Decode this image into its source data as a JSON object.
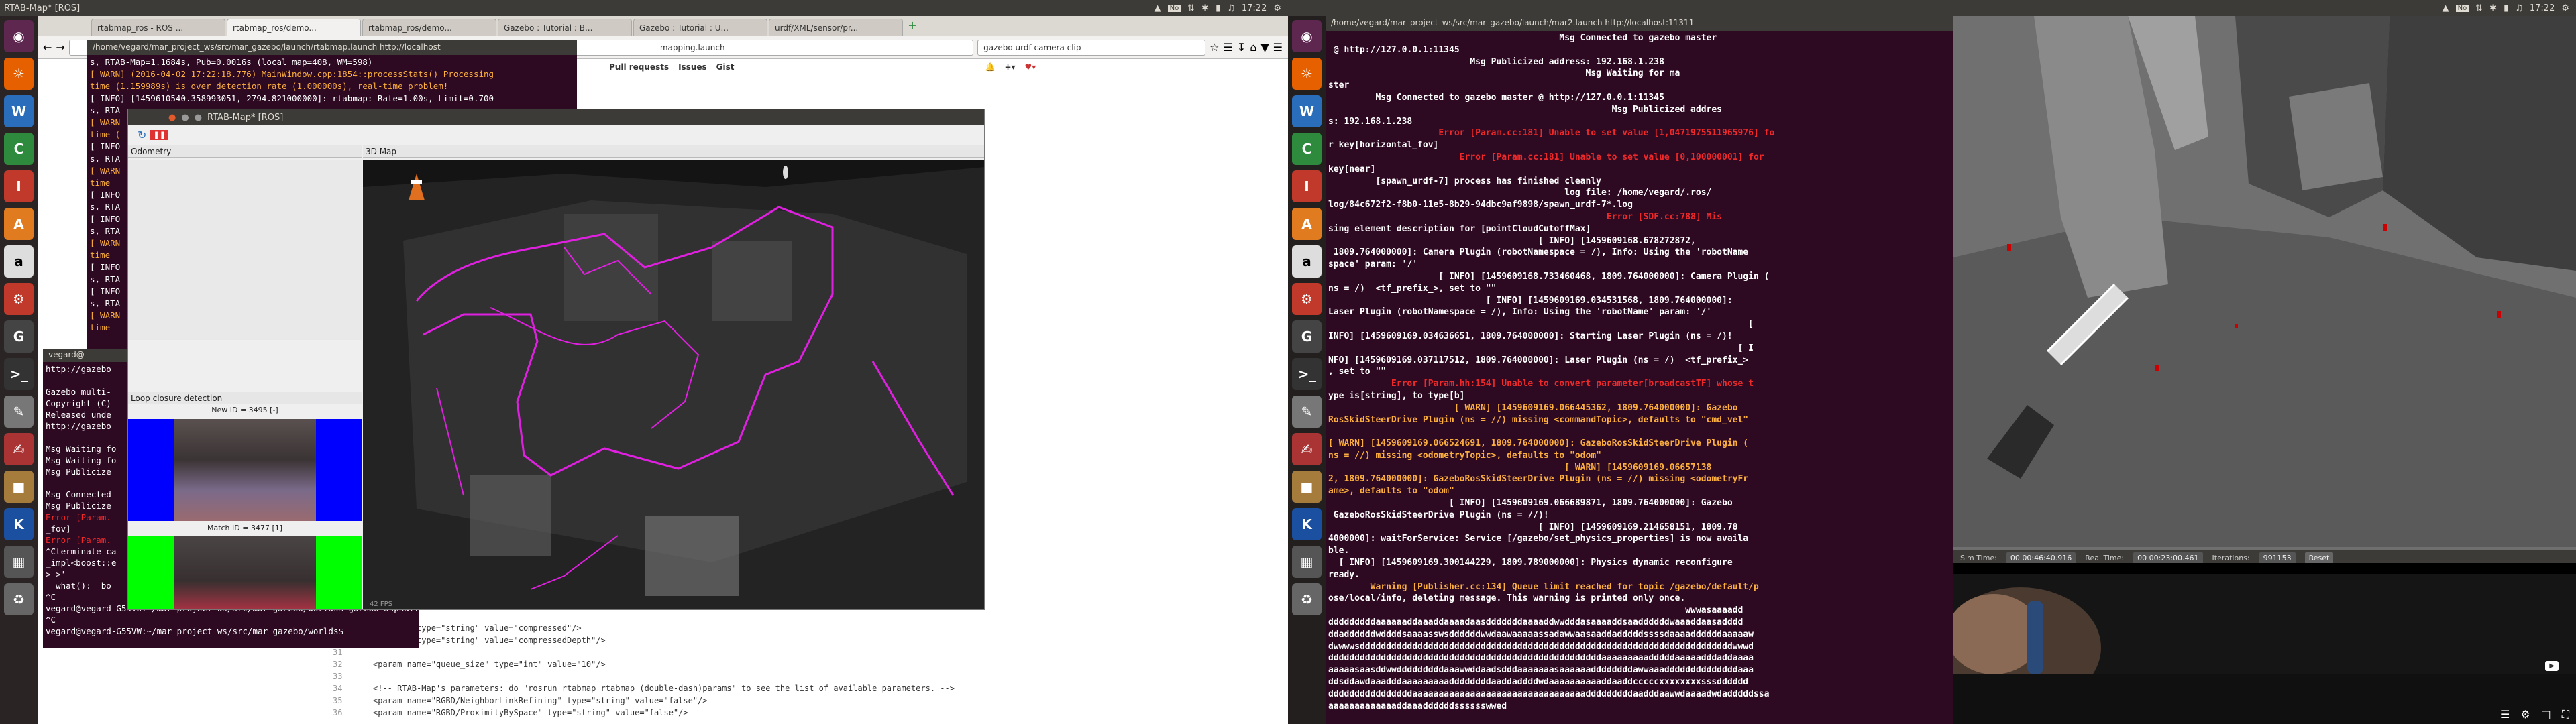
{
  "left": {
    "window_title": "RTAB-Map* [ROS]",
    "clock": "17:22",
    "browser": {
      "tabs": [
        "rtabmap_ros - ROS ...",
        "rtabmap_ros/demo...",
        "rtabmap_ros/demo...",
        "Gazebo : Tutorial : B...",
        "Gazebo : Tutorial : U...",
        "urdf/XML/sensor/pr..."
      ],
      "search_text": "gazebo urdf camera clip",
      "url_text": "mapping.launch",
      "gh_links": [
        "Pull requests",
        "Issues",
        "Gist"
      ]
    },
    "term_top": {
      "title": "/home/vegard/mar_project_ws/src/mar_gazebo/launch/rtabmap.launch http://localhost",
      "lines": [
        {
          "t": "s, RTAB-Map=1.1684s, Pub=0.0016s (local map=408, WM=598)",
          "c": "dark"
        },
        {
          "t": "[ WARN] (2016-04-02 17:22:18.776) MainWindow.cpp:1854::processStats() Processing",
          "c": "warn"
        },
        {
          "t": "time (1.159989s) is over detection rate (1.000000s), real-time problem!",
          "c": "warn"
        },
        {
          "t": "[ INFO] [1459610540.358993051, 2794.821000000]: rtabmap: Rate=1.00s, Limit=0.700",
          "c": "dark"
        },
        {
          "t": "s, RTA",
          "c": "dark"
        },
        {
          "t": "[ WARN",
          "c": "warn"
        },
        {
          "t": "time (",
          "c": "warn"
        },
        {
          "t": "[ INFO",
          "c": "dark"
        },
        {
          "t": "s, RTA",
          "c": "dark"
        },
        {
          "t": "[ WARN",
          "c": "warn"
        },
        {
          "t": "time",
          "c": "warn"
        },
        {
          "t": "[ INFO",
          "c": "dark"
        },
        {
          "t": "s, RTA",
          "c": "dark"
        },
        {
          "t": "[ INFO",
          "c": "dark"
        },
        {
          "t": "s, RTA",
          "c": "dark"
        },
        {
          "t": "[ WARN",
          "c": "warn"
        },
        {
          "t": "time",
          "c": "warn"
        },
        {
          "t": "[ INFO",
          "c": "dark"
        },
        {
          "t": "s, RTA",
          "c": "dark"
        },
        {
          "t": "[ INFO",
          "c": "dark"
        },
        {
          "t": "s, RTA",
          "c": "dark"
        },
        {
          "t": "[ WARN",
          "c": "warn"
        },
        {
          "t": "time",
          "c": "warn"
        }
      ]
    },
    "term_bottom": {
      "title": "vegard@",
      "lines": [
        {
          "t": "http://gazebo",
          "c": "dark"
        },
        {
          "t": "",
          "c": "dark"
        },
        {
          "t": "Gazebo multi-",
          "c": "dark"
        },
        {
          "t": "Copyright (C)",
          "c": "dark"
        },
        {
          "t": "Released unde",
          "c": "dark"
        },
        {
          "t": "http://gazebo",
          "c": "dark"
        },
        {
          "t": "",
          "c": "dark"
        },
        {
          "t": "Msg Waiting fo",
          "c": "dark"
        },
        {
          "t": "Msg Waiting fo",
          "c": "dark"
        },
        {
          "t": "Msg Publicize",
          "c": "dark"
        },
        {
          "t": "",
          "c": "dark"
        },
        {
          "t": "Msg Connected",
          "c": "dark"
        },
        {
          "t": "Msg Publicize",
          "c": "dark"
        },
        {
          "t": "Error [Param.",
          "c": "err"
        },
        {
          "t": "_fov]",
          "c": "dark"
        },
        {
          "t": "Error [Param.",
          "c": "err"
        },
        {
          "t": "^Cterminate ca",
          "c": "dark"
        },
        {
          "t": "_impl<boost::e",
          "c": "dark"
        },
        {
          "t": "> >'",
          "c": "dark"
        },
        {
          "t": "  what():  bo",
          "c": "dark"
        },
        {
          "t": "^C",
          "c": "dark"
        },
        {
          "t": "vegard@vegard-G55VW:~/mar_project_ws/src/mar_gazebo/worlds$ gazebo asphalt.world",
          "c": "dark"
        },
        {
          "t": "^C",
          "c": "dark"
        },
        {
          "t": "vegard@vegard-G55VW:~/mar_project_ws/src/mar_gazebo/worlds$ ",
          "c": "dark"
        }
      ]
    },
    "code_lines": [
      {
        "n": "",
        "t": "ansport\"    type=\"string\" value=\"compressed\"/>"
      },
      {
        "n": "",
        "t": "ansport\"   type=\"string\" value=\"compressedDepth\"/>"
      },
      {
        "n": "31",
        "t": ""
      },
      {
        "n": "32",
        "t": "<param name=\"queue_size\" type=\"int\" value=\"10\"/>"
      },
      {
        "n": "33",
        "t": ""
      },
      {
        "n": "34",
        "t": "<!-- RTAB-Map's parameters: do \"rosrun rtabmap rtabmap (double-dash)params\" to see the list of available parameters. -->"
      },
      {
        "n": "35",
        "t": "<param name=\"RGBD/NeighborLinkRefining\" type=\"string\" value=\"false\"/>"
      },
      {
        "n": "36",
        "t": "<param name=\"RGBD/ProximityBySpace\"     type=\"string\" value=\"false\"/>"
      }
    ],
    "rtabmap": {
      "title": "RTAB-Map* [ROS]",
      "odometry_title": "Odometry",
      "loop_title": "Loop closure detection",
      "map3d_title": "3D Map",
      "new_id": "New ID = 3495 [-]",
      "match_id": "Match ID = 3477 [1]",
      "fps": "42 FPS"
    }
  },
  "right": {
    "clock": "17:22",
    "term_title": "/home/vegard/mar_project_ws/src/mar_gazebo/launch/mar2.launch http://localhost:11311",
    "lines": [
      {
        "t": "                                            Msg Connected to gazebo master",
        "c": "dark"
      },
      {
        "t": " @ http://127.0.0.1:11345",
        "c": "dark"
      },
      {
        "t": "                           Msg Publicized address: 192.168.1.238",
        "c": "dark"
      },
      {
        "t": "                                                 Msg Waiting for ma",
        "c": "dark"
      },
      {
        "t": "ster",
        "c": "dark"
      },
      {
        "t": "         Msg Connected to gazebo master @ http://127.0.0.1:11345",
        "c": "dark"
      },
      {
        "t": "                                                      Msg Publicized addres",
        "c": "dark"
      },
      {
        "t": "s: 192.168.1.238",
        "c": "dark"
      },
      {
        "t": "                     Error [Param.cc:181] Unable to set value [1,0471975511965976] fo",
        "c": "err"
      },
      {
        "t": "r key[horizontal_fov]",
        "c": "dark"
      },
      {
        "t": "                         Error [Param.cc:181] Unable to set value [0,100000001] for",
        "c": "err"
      },
      {
        "t": "key[near]",
        "c": "dark"
      },
      {
        "t": "         [spawn_urdf-7] process has finished cleanly",
        "c": "dark"
      },
      {
        "t": "                                             log file: /home/vegard/.ros/",
        "c": "dark"
      },
      {
        "t": "log/84c672f2-f8b0-11e5-8b29-94dbc9af9898/spawn_urdf-7*.log",
        "c": "dark"
      },
      {
        "t": "                                                     Error [SDF.cc:788] Mis",
        "c": "err"
      },
      {
        "t": "sing element description for [pointCloudCutoffMax]",
        "c": "dark"
      },
      {
        "t": "                                        [ INFO] [1459609168.678272872,",
        "c": "dark"
      },
      {
        "t": " 1809.764000000]: Camera Plugin (robotNamespace = /), Info: Using the 'robotName",
        "c": "dark"
      },
      {
        "t": "space' param: '/'",
        "c": "dark"
      },
      {
        "t": "                     [ INFO] [1459609168.733460468, 1809.764000000]: Camera Plugin (",
        "c": "dark"
      },
      {
        "t": "ns = /)  <tf_prefix_>, set to \"\"",
        "c": "dark"
      },
      {
        "t": "                              [ INFO] [1459609169.034531568, 1809.764000000]:",
        "c": "dark"
      },
      {
        "t": "Laser Plugin (robotNamespace = /), Info: Using the 'robotName' param: '/'",
        "c": "dark"
      },
      {
        "t": "                                                                                [",
        "c": "dark"
      },
      {
        "t": "INFO] [1459609169.034636651, 1809.764000000]: Starting Laser Plugin (ns = /)!",
        "c": "dark"
      },
      {
        "t": "                                                                              [ I",
        "c": "dark"
      },
      {
        "t": "NFO] [1459609169.037117512, 1809.764000000]: Laser Plugin (ns = /)  <tf_prefix_>",
        "c": "dark"
      },
      {
        "t": ", set to \"\"",
        "c": "dark"
      },
      {
        "t": "            Error [Param.hh:154] Unable to convert parameter[broadcastTF] whose t",
        "c": "err"
      },
      {
        "t": "ype is[string], to type[b]",
        "c": "dark"
      },
      {
        "t": "                        [ WARN] [1459609169.066445362, 1809.764000000]: Gazebo",
        "c": "warn"
      },
      {
        "t": "RosSkidSteerDrive Plugin (ns = //) missing <commandTopic>, defaults to \"cmd_vel\"",
        "c": "warn"
      },
      {
        "t": "",
        "c": "dark"
      },
      {
        "t": "[ WARN] [1459609169.066524691, 1809.764000000]: GazeboRosSkidSteerDrive Plugin (",
        "c": "warn"
      },
      {
        "t": "ns = //) missing <odometryTopic>, defaults to \"odom\"",
        "c": "warn"
      },
      {
        "t": "                                             [ WARN] [1459609169.06657138",
        "c": "warn"
      },
      {
        "t": "2, 1809.764000000]: GazeboRosSkidSteerDrive Plugin (ns = //) missing <odometryFr",
        "c": "warn"
      },
      {
        "t": "ame>, defaults to \"odom\"",
        "c": "warn"
      },
      {
        "t": "                       [ INFO] [1459609169.066689871, 1809.764000000]: Gazebo",
        "c": "dark"
      },
      {
        "t": " GazeboRosSkidSteerDrive Plugin (ns = //)!",
        "c": "dark"
      },
      {
        "t": "                                        [ INFO] [1459609169.214658151, 1809.78",
        "c": "dark"
      },
      {
        "t": "4000000]: waitForService: Service [/gazebo/set_physics_properties] is now availa",
        "c": "dark"
      },
      {
        "t": "ble.",
        "c": "dark"
      },
      {
        "t": "  [ INFO] [1459609169.300144229, 1809.789000000]: Physics dynamic reconfigure",
        "c": "dark"
      },
      {
        "t": "ready.",
        "c": "dark"
      },
      {
        "t": "        Warning [Publisher.cc:134] Queue limit reached for topic /gazebo/default/p",
        "c": "warn"
      },
      {
        "t": "ose/local/info, deleting message. This warning is printed only once.",
        "c": "dark"
      },
      {
        "t": "                                                                    wwwasaaaadd",
        "c": "dark"
      },
      {
        "t": "dddddddddaaaaaaddaaaddaaaadaasdddddddaaaaddwwdddasaaaaddsaaddddddwaaaddaasadddd",
        "c": "dark"
      },
      {
        "t": "ddaddddddwddddsaaaasswsddddddwwdaawaaaaassadawwaasaaddadddddssssdaaaaddddddaaaaaw",
        "c": "dark"
      },
      {
        "t": "dwwwwsdddddddddddddddddddddddddddddddddddddddddddddddddddddddddddddddddddddddwwwd",
        "c": "dark"
      },
      {
        "t": "ddddddddddddddddddddddddddddddddddddddddddddddddddddaaaaaaaaadddddaaaaadddaddaaaa",
        "c": "dark"
      },
      {
        "t": "aaaaasaasddwwdddddddddaaawwddaadsdddaaaaaaasaaaaaaddddddddawwaaaddddddddddddddaaa",
        "c": "dark"
      },
      {
        "t": "ddsddawdaaadddaaaaaaaaaddddddddaaddaddddwdaaaaaaaaaaddaaddcccccxxxxxxxxsssdddddd",
        "c": "dark"
      },
      {
        "t": "ddddddddddddddddaaaaaaaaaaaaaaaaaaaaaaaaaaaaaaaaadddddddddaadddaawwdaaaadwdadddddssa",
        "c": "dark"
      },
      {
        "t": "aaaaaaaaaaaaaddaaaddddddsssssswwed",
        "c": "dark"
      }
    ],
    "gazebo": {
      "sim_time_label": "Sim Time:",
      "sim_time": "00 00:46:40.916",
      "real_time_label": "Real Time:",
      "real_time": "00 00:23:00.461",
      "iterations_label": "Iterations:",
      "iterations": "991153",
      "reset_label": "Reset"
    }
  }
}
